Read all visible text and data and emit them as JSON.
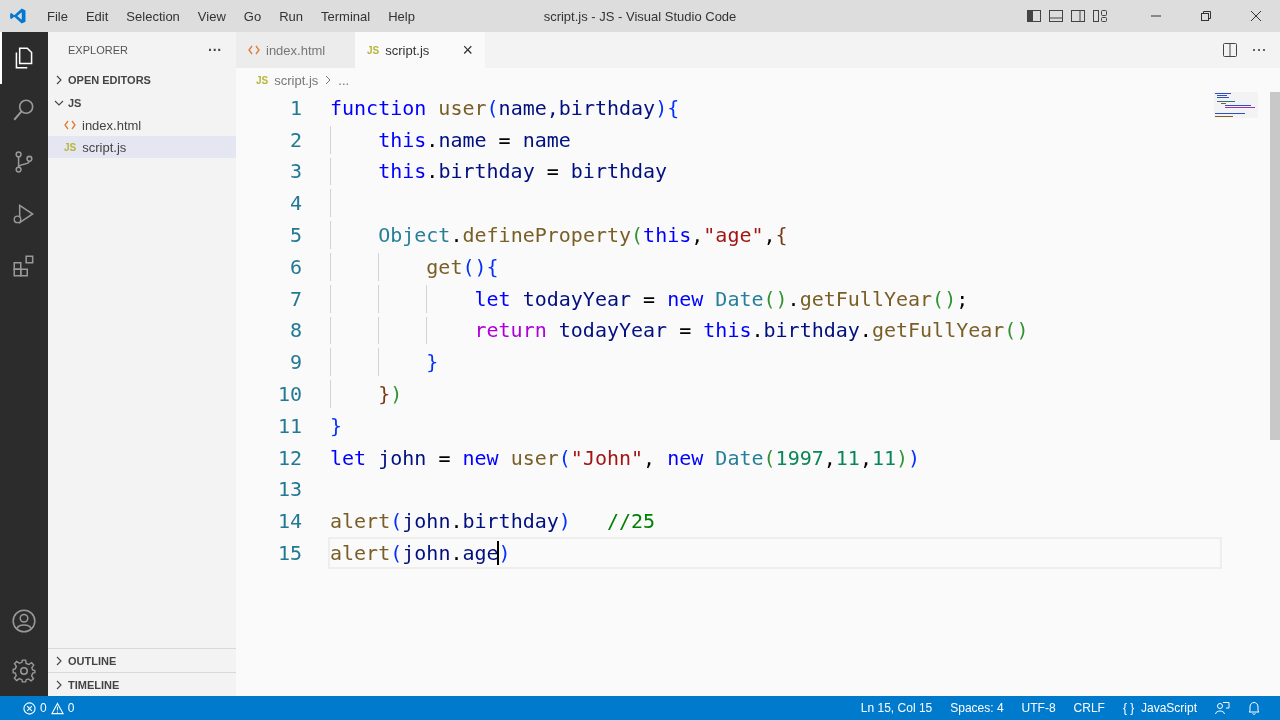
{
  "window": {
    "title": "script.js - JS - Visual Studio Code"
  },
  "menu": [
    "File",
    "Edit",
    "Selection",
    "View",
    "Go",
    "Run",
    "Terminal",
    "Help"
  ],
  "sidebar": {
    "title": "EXPLORER",
    "more": "···",
    "sections": [
      {
        "label": "OPEN EDITORS",
        "expanded": false
      },
      {
        "label": "JS",
        "expanded": true,
        "children": [
          {
            "name": "index.html",
            "kind": "html",
            "selected": false
          },
          {
            "name": "script.js",
            "kind": "js",
            "badge": "JS",
            "selected": true
          }
        ]
      }
    ],
    "bottom_sections": [
      {
        "label": "OUTLINE",
        "expanded": false
      },
      {
        "label": "TIMELINE",
        "expanded": false
      }
    ]
  },
  "tabs": [
    {
      "label": "index.html",
      "kind": "html",
      "selected": false
    },
    {
      "label": "script.js",
      "kind": "js",
      "badge": "JS",
      "selected": true,
      "close": "×"
    }
  ],
  "breadcrumb": {
    "badge": "JS",
    "file": "script.js",
    "rest": "..."
  },
  "editor": {
    "lines": [
      {
        "number": "1",
        "current": false,
        "tokens": [
          {
            "kind": "keyword",
            "text": "function"
          },
          {
            "kind": "function",
            "text": " user"
          },
          {
            "kind": "bracket1",
            "text": "("
          },
          {
            "kind": "variable",
            "text": "name,birthday"
          },
          {
            "kind": "bracket1",
            "text": ")"
          },
          {
            "kind": "bracket1",
            "text": "{"
          }
        ]
      },
      {
        "number": "2",
        "current": false,
        "tokens": [
          {
            "kind": "keyword",
            "text": "    this"
          },
          {
            "kind": "punct",
            "text": "."
          },
          {
            "kind": "variable",
            "text": "name"
          },
          {
            "kind": "punct",
            "text": " = "
          },
          {
            "kind": "variable",
            "text": "name"
          }
        ]
      },
      {
        "number": "3",
        "current": false,
        "tokens": [
          {
            "kind": "keyword",
            "text": "    this"
          },
          {
            "kind": "punct",
            "text": "."
          },
          {
            "kind": "variable",
            "text": "birthday"
          },
          {
            "kind": "punct",
            "text": " = "
          },
          {
            "kind": "variable",
            "text": "birthday"
          }
        ]
      },
      {
        "number": "4",
        "current": false
      },
      {
        "number": "5",
        "current": false,
        "tokens": [
          {
            "kind": "class",
            "text": "    Object"
          },
          {
            "kind": "punct",
            "text": "."
          },
          {
            "kind": "function",
            "text": "defineProperty"
          },
          {
            "kind": "bracket2",
            "text": "("
          },
          {
            "kind": "keyword",
            "text": "this"
          },
          {
            "kind": "punct",
            "text": ","
          },
          {
            "kind": "string",
            "text": "\"age\""
          },
          {
            "kind": "punct",
            "text": ","
          },
          {
            "kind": "bracket3",
            "text": "{"
          }
        ]
      },
      {
        "number": "6",
        "current": false,
        "tokens": [
          {
            "kind": "function",
            "text": "        get"
          },
          {
            "kind": "bracket1",
            "text": "("
          },
          {
            "kind": "bracket1",
            "text": ")"
          },
          {
            "kind": "bracket1",
            "text": "{"
          }
        ]
      },
      {
        "number": "7",
        "current": false,
        "tokens": [
          {
            "kind": "keyword",
            "text": "            let"
          },
          {
            "kind": "variable",
            "text": " todayYear"
          },
          {
            "kind": "punct",
            "text": " = "
          },
          {
            "kind": "keyword",
            "text": "new"
          },
          {
            "kind": "class",
            "text": " Date"
          },
          {
            "kind": "bracket2",
            "text": "("
          },
          {
            "kind": "bracket2",
            "text": ")"
          },
          {
            "kind": "punct",
            "text": "."
          },
          {
            "kind": "function",
            "text": "getFullYear"
          },
          {
            "kind": "bracket2",
            "text": "("
          },
          {
            "kind": "bracket2",
            "text": ")"
          },
          {
            "kind": "punct",
            "text": ";"
          }
        ]
      },
      {
        "number": "8",
        "current": false,
        "tokens": [
          {
            "kind": "control",
            "text": "            return"
          },
          {
            "kind": "variable",
            "text": " todayYear"
          },
          {
            "kind": "punct",
            "text": " = "
          },
          {
            "kind": "keyword",
            "text": "this"
          },
          {
            "kind": "punct",
            "text": "."
          },
          {
            "kind": "variable",
            "text": "birthday"
          },
          {
            "kind": "punct",
            "text": "."
          },
          {
            "kind": "function",
            "text": "getFullYear"
          },
          {
            "kind": "bracket2",
            "text": "("
          },
          {
            "kind": "bracket2",
            "text": ")"
          }
        ]
      },
      {
        "number": "9",
        "current": false,
        "tokens": [
          {
            "kind": "bracket1",
            "text": "        }"
          }
        ]
      },
      {
        "number": "10",
        "current": false,
        "tokens": [
          {
            "kind": "bracket3",
            "text": "    }"
          },
          {
            "kind": "bracket2",
            "text": ")"
          }
        ]
      },
      {
        "number": "11",
        "current": false,
        "tokens": [
          {
            "kind": "bracket1",
            "text": "}"
          }
        ]
      },
      {
        "number": "12",
        "current": false,
        "tokens": [
          {
            "kind": "keyword",
            "text": "let"
          },
          {
            "kind": "variable",
            "text": " john"
          },
          {
            "kind": "punct",
            "text": " = "
          },
          {
            "kind": "keyword",
            "text": "new"
          },
          {
            "kind": "function",
            "text": " user"
          },
          {
            "kind": "bracket1",
            "text": "("
          },
          {
            "kind": "string",
            "text": "\"John\""
          },
          {
            "kind": "punct",
            "text": ", "
          },
          {
            "kind": "keyword",
            "text": "new"
          },
          {
            "kind": "class",
            "text": " Date"
          },
          {
            "kind": "bracket2",
            "text": "("
          },
          {
            "kind": "number",
            "text": "1997"
          },
          {
            "kind": "punct",
            "text": ","
          },
          {
            "kind": "number",
            "text": "11"
          },
          {
            "kind": "punct",
            "text": ","
          },
          {
            "kind": "number",
            "text": "11"
          },
          {
            "kind": "bracket2",
            "text": ")"
          },
          {
            "kind": "bracket1",
            "text": ")"
          }
        ]
      },
      {
        "number": "13",
        "current": false
      },
      {
        "number": "14",
        "current": false,
        "tokens": [
          {
            "kind": "function",
            "text": "alert"
          },
          {
            "kind": "bracket1",
            "text": "("
          },
          {
            "kind": "variable",
            "text": "john"
          },
          {
            "kind": "punct",
            "text": "."
          },
          {
            "kind": "variable",
            "text": "birthday"
          },
          {
            "kind": "bracket1",
            "text": ")"
          },
          {
            "kind": "comment",
            "text": "   //25"
          }
        ]
      },
      {
        "number": "15",
        "current": true,
        "tokens": [
          {
            "kind": "function",
            "text": "alert"
          },
          {
            "kind": "bracket1",
            "text": "("
          },
          {
            "kind": "variable",
            "text": "john"
          },
          {
            "kind": "punct",
            "text": "."
          },
          {
            "kind": "variable",
            "text": "age"
          },
          {
            "kind": "bracket1",
            "text": ")"
          }
        ]
      }
    ]
  },
  "status_bar": {
    "errors": "0",
    "warnings": "0",
    "items": [
      {
        "text": "Ln 15, Col 15"
      },
      {
        "text": "Spaces: 4"
      },
      {
        "text": "UTF-8"
      },
      {
        "text": "CRLF"
      },
      {
        "icon_text": "{ }",
        "text": "JavaScript"
      }
    ]
  }
}
